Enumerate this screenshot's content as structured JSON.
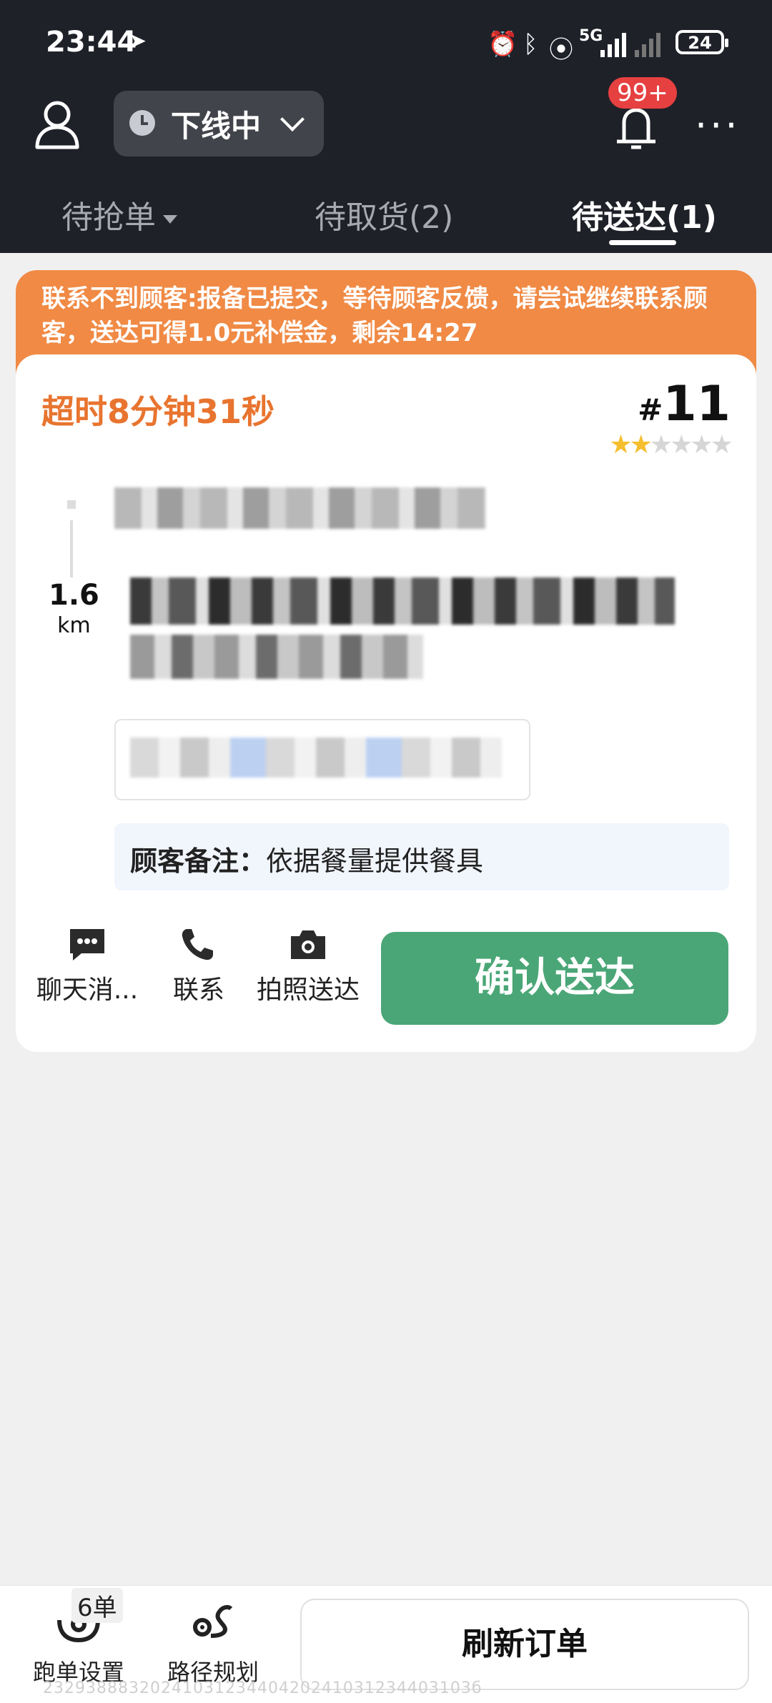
{
  "status_bar": {
    "time": "23:44",
    "network": "5G",
    "battery": "24"
  },
  "topbar": {
    "status_label": "下线中",
    "badge": "99+"
  },
  "tabs": [
    {
      "label": "待抢单"
    },
    {
      "label": "待取货(2)"
    },
    {
      "label": "待送达(1)"
    }
  ],
  "notice": {
    "text": "联系不到顾客:报备已提交，等待顾客反馈，请尝试继续联系顾客，送达可得1.0元补偿金，剩余14:27"
  },
  "order": {
    "overtime": "超时8分钟31秒",
    "hash": "#",
    "number": "11",
    "rating": 2,
    "distance_value": "1.6",
    "distance_unit": "km",
    "remark_label": "顾客备注：",
    "remark_value": "依据餐量提供餐具",
    "actions": {
      "chat": "聊天消...",
      "contact": "联系",
      "photo": "拍照送达"
    },
    "confirm_label": "确认送达"
  },
  "bottom": {
    "settings_label": "跑单设置",
    "settings_badge": "6单",
    "route_label": "路径规划",
    "refresh_label": "刷新订单",
    "footer_code": "2329388832024103123440420241031234403103б"
  },
  "colors": {
    "accent_orange": "#e8742f",
    "notice_bg": "#f08a45",
    "confirm_green": "#4aa676",
    "header_bg": "#1f2129"
  }
}
